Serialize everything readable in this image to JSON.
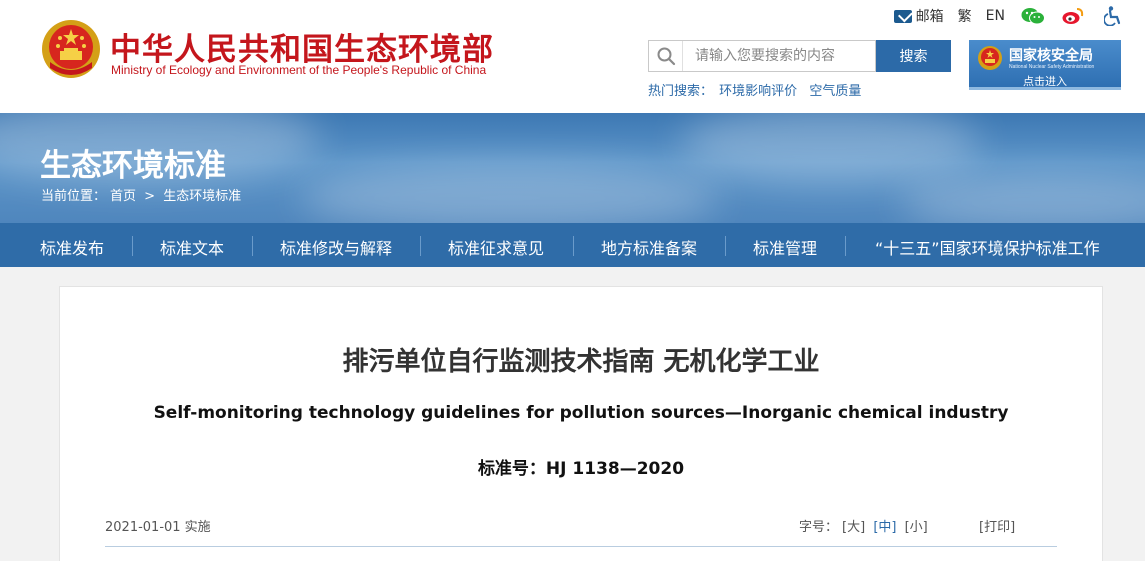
{
  "header": {
    "site_title": "中华人民共和国生态环境部",
    "site_subtitle": "Ministry of Ecology and Environment of the People's Republic of China",
    "toplinks": {
      "mail": "邮箱",
      "traditional": "繁",
      "english": "EN"
    },
    "search": {
      "placeholder": "请输入您要搜索的内容",
      "button": "搜索"
    },
    "hot_search": {
      "label": "热门搜索：",
      "items": [
        "环境影响评价",
        "空气质量"
      ]
    },
    "nnsa": {
      "title": "国家核安全局",
      "subtitle": "National Nuclear Safety Administration",
      "enter": "点击进入"
    }
  },
  "banner": {
    "title": "生态环境标准",
    "breadcrumb": {
      "prefix": "当前位置：",
      "home": "首页",
      "sep": ">",
      "current": "生态环境标准"
    }
  },
  "nav": {
    "items": [
      "标准发布",
      "标准文本",
      "标准修改与解释",
      "标准征求意见",
      "地方标准备案",
      "标准管理",
      "“十三五”国家环境保护标准工作"
    ]
  },
  "document": {
    "title": "排污单位自行监测技术指南 无机化学工业",
    "title_en": "Self-monitoring technology guidelines for pollution sources—Inorganic chemical industry",
    "code": "标准号：HJ 1138—2020",
    "date": "2021-01-01 实施",
    "font_size": {
      "label": "字号：",
      "large": "[大]",
      "medium": "[中]",
      "small": "[小]"
    },
    "print": "[打印]"
  },
  "colors": {
    "brand_red": "#c4161c",
    "nav_blue": "#2f6ca8",
    "search_blue": "#2c6aa8"
  },
  "icons": [
    "national-emblem-icon",
    "mail-icon",
    "wechat-icon",
    "weibo-icon",
    "accessibility-icon",
    "search-icon"
  ]
}
